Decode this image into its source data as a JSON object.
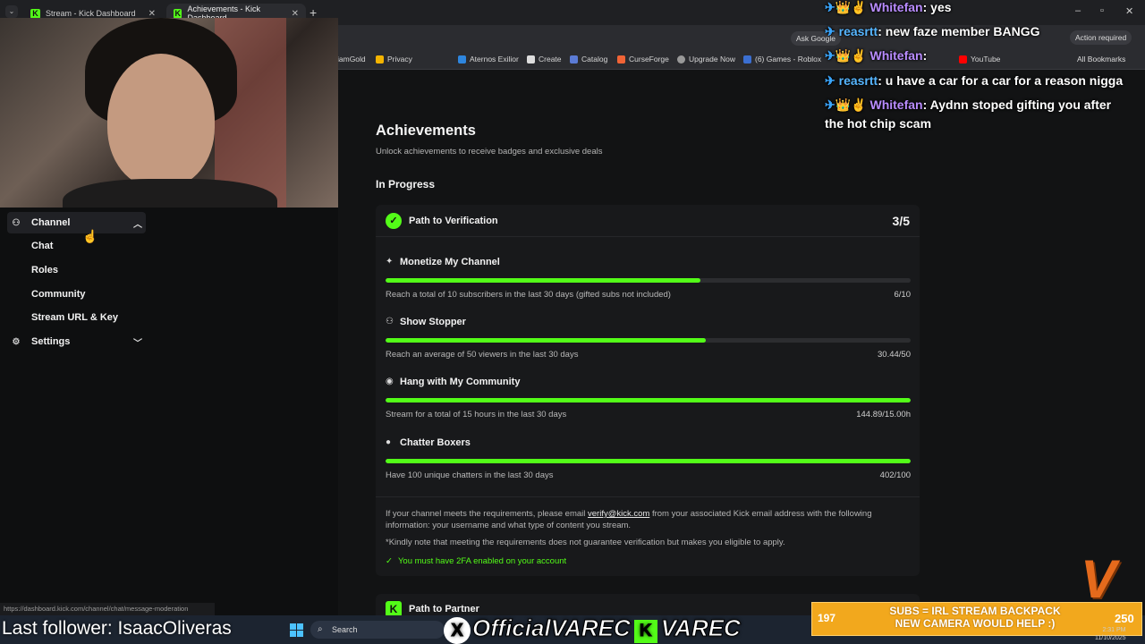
{
  "browser": {
    "tabs": [
      {
        "title": "Stream - Kick Dashboard"
      },
      {
        "title": "Achievements - Kick Dashboard"
      }
    ],
    "ask_google": "Ask Google",
    "action_required": "Action required",
    "bookmarks": [
      "iamGold",
      "Privacy",
      "Aternos Exilior",
      "Create",
      "Catalog",
      "CurseForge",
      "Upgrade Now",
      "(6) Games - Roblox",
      "YouTube"
    ],
    "all_bookmarks": "All Bookmarks",
    "status_url": "https://dashboard.kick.com/channel/chat/message-moderation"
  },
  "sidebar": {
    "channel": "Channel",
    "sub_items": [
      "Chat",
      "Roles",
      "Community",
      "Stream URL & Key"
    ],
    "settings": "Settings"
  },
  "page": {
    "title": "Achievements",
    "subtitle": "Unlock achievements to receive badges and exclusive deals",
    "section": "In Progress"
  },
  "card": {
    "title": "Path to Verification",
    "progress": "3/5",
    "tasks": [
      {
        "name": "Monetize My Channel",
        "icon": "sparkle-icon",
        "desc": "Reach a total of 10 subscribers in the last 30 days (gifted subs not included)",
        "value": "6/10",
        "fill": 0.6
      },
      {
        "name": "Show Stopper",
        "icon": "users-icon",
        "desc": "Reach an average of 50 viewers in the last 30 days",
        "value": "30.44/50",
        "fill": 0.61
      },
      {
        "name": "Hang with My Community",
        "icon": "broadcast-icon",
        "desc": "Stream for a total of 15 hours in the last 30 days",
        "value": "144.89/15.00h",
        "fill": 1.0
      },
      {
        "name": "Chatter Boxers",
        "icon": "chat-bubble-icon",
        "desc": "Have 100 unique chatters in the last 30 days",
        "value": "402/100",
        "fill": 1.0
      }
    ],
    "info_before": "If your channel meets the requirements, please email ",
    "info_email": "verify@kick.com",
    "info_after": " from your associated Kick email address with the following information: your username and what type of content you stream.",
    "note": "*Kindly note that meeting the requirements does not guarantee verification but makes you eligible to apply.",
    "twofa": "You must have 2FA enabled on your account"
  },
  "card2": {
    "title": "Path to Partner"
  },
  "chat": [
    {
      "name": "Whitefan",
      "color": "purple",
      "msg": "yes"
    },
    {
      "name": "reasrtt",
      "color": "blue",
      "msg": "new faze member BANGG"
    },
    {
      "name": "Whitefan",
      "color": "purple",
      "msg": ""
    },
    {
      "name": "reasrtt",
      "color": "blue",
      "msg": "u have a car for a car for a reason nigga"
    },
    {
      "name": "Whitefan",
      "color": "purple",
      "msg": "Aydnn stoped gifting you after"
    },
    {
      "name": "",
      "color": "",
      "msg": "the hot chip scam"
    }
  ],
  "overlay": {
    "last_follower": "Last follower: IsaacOliveras",
    "social_x": "OfficialVAREC",
    "social_kick": "VAREC",
    "subs_left": "197",
    "subs_msg_1": "SUBS = IRL STREAM BACKPACK",
    "subs_msg_2": "NEW CAMERA WOULD HELP :)",
    "subs_right": "250",
    "taskbar_search": "Search",
    "clock_date": "11/10/2025",
    "clock_time": "2:31 PM"
  },
  "colors": {
    "accent": "#53fc18",
    "background": "#121314",
    "card": "#18191b"
  }
}
